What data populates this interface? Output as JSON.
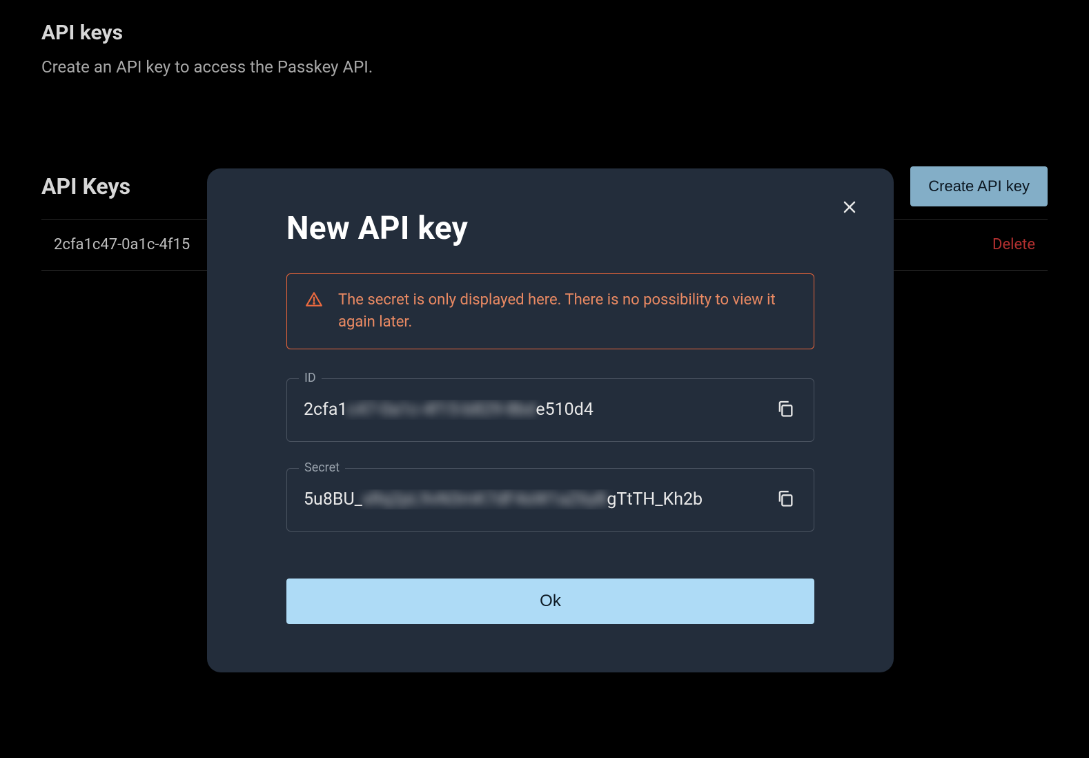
{
  "page": {
    "section_title": "API keys",
    "section_desc": "Create an API key to access the Passkey API.",
    "keys_subtitle": "API Keys",
    "create_button": "Create API key",
    "keys": [
      {
        "id": "2cfa1c47-0a1c-4f15",
        "delete_label": "Delete"
      }
    ]
  },
  "modal": {
    "title": "New API key",
    "close_label": "Close",
    "warning": "The secret is only displayed here. There is no possibility to view it again later.",
    "id_label": "ID",
    "id_value": {
      "prefix": "2cfa1",
      "redacted": "c47-0a1c-4f15-b829-8bd",
      "suffix": "e510d4"
    },
    "secret_label": "Secret",
    "secret_value": {
      "prefix": "5u8BU_",
      "redacted": "xRq2pL9vN3mK7dF4sW1aZ6yB",
      "suffix": "gTtTH_Kh2b"
    },
    "copy_label": "Copy",
    "ok_label": "Ok"
  },
  "colors": {
    "modal_bg": "#232d3b",
    "accent_warning": "#e8653a",
    "primary_button": "#aedbf6",
    "secondary_button": "#83aec7",
    "danger": "#b33030"
  }
}
